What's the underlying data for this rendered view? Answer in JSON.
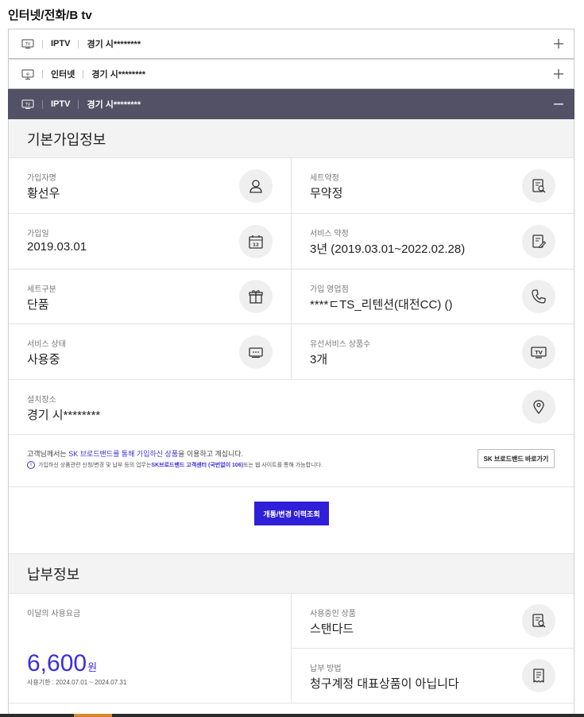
{
  "page": {
    "title": "인터넷/전화/B tv"
  },
  "accordion": [
    {
      "icon": "tv-icon",
      "type": "IPTV",
      "address": "경기 시********",
      "toggle": "plus-icon",
      "active": false
    },
    {
      "icon": "monitor-icon",
      "type": "인터넷",
      "address": "경기 시********",
      "toggle": "plus-icon",
      "active": false
    },
    {
      "icon": "tv-icon",
      "type": "IPTV",
      "address": "경기 시********",
      "toggle": "minus-icon",
      "active": true
    }
  ],
  "basic_info": {
    "heading": "기본가입정보",
    "fields": [
      {
        "key": "가입자명",
        "value": "황선우",
        "icon": "user-icon"
      },
      {
        "key": "세트약정",
        "value": "무약정",
        "icon": "document-search-icon"
      },
      {
        "key": "가입일",
        "value": "2019.03.01",
        "icon": "calendar-icon"
      },
      {
        "key": "서비스 약정",
        "value": "3년 (2019.03.01~2022.02.28)",
        "icon": "document-edit-icon"
      },
      {
        "key": "세트구분",
        "value": "단품",
        "icon": "gift-icon"
      },
      {
        "key": "가입 영업점",
        "value": "****ㄷTS_리텐션(대전CC) ()",
        "icon": "phone-icon"
      },
      {
        "key": "서비스 상태",
        "value": "사용중",
        "icon": "settop-box-icon"
      },
      {
        "key": "유선서비스 상품수",
        "value": "3개",
        "icon": "tv-icon"
      },
      {
        "key": "설치장소",
        "value": "경기 시********",
        "icon": "location-pin-icon"
      }
    ]
  },
  "notice": {
    "line1_pre": "고객님께서는 ",
    "line1_hl": "SK 브로드밴드를 통해 가입하신 상품",
    "line1_post": "을 이용하고 계십니다.",
    "line2_pre": "가입하신 상품관련 신청/변경 및 납부 등의 업무는 ",
    "line2_hl": "SK브로드밴드 고객센터 (국번없이 106)",
    "line2_post": " 또는 웹 사이트를 통해 가능합니다.",
    "info_icon": "i",
    "button": "SK 브로드밴드 바로가기"
  },
  "history_button": "개통/변경 이력조회",
  "payment": {
    "heading": "납부정보",
    "usage_label": "이달의 사용요금",
    "amount": "6,600",
    "unit": "원",
    "period": "사용기한 : 2024.07.01 ~ 2024.07.31",
    "fields": [
      {
        "key": "사용중인 상품",
        "value": "스탠다드",
        "icon": "document-search-icon"
      },
      {
        "key": "납부 방법",
        "value": "청구계정 대표상품이 아닙니다",
        "icon": "receipt-icon"
      }
    ]
  }
}
